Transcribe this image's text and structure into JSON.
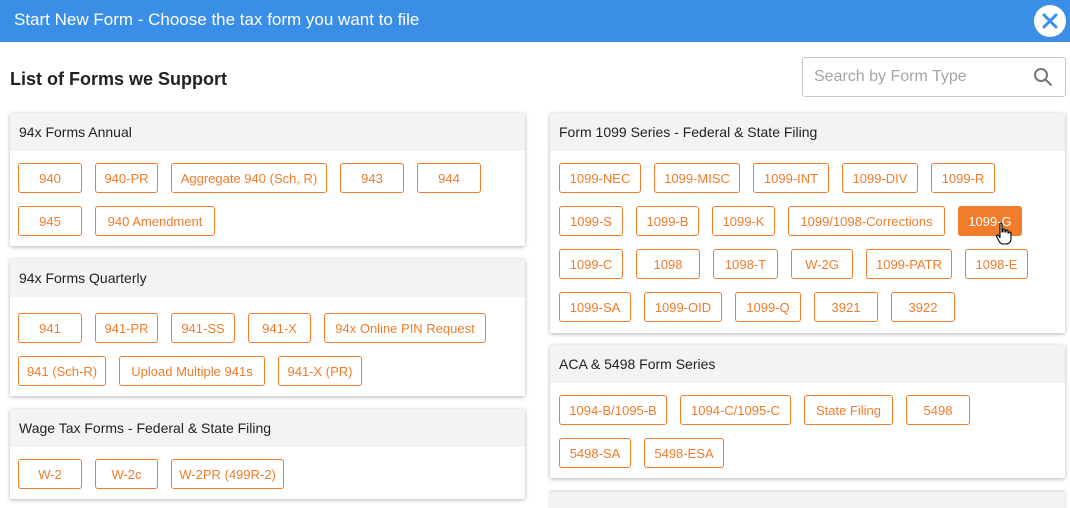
{
  "header": {
    "title": "Start New Form - Choose the tax form you want to file",
    "close_icon": "close-icon",
    "colors": {
      "bar": "#3b8ee6",
      "accent": "#f07c2c"
    }
  },
  "list_title": "List of Forms we Support",
  "search": {
    "placeholder": "Search by Form Type",
    "value": "",
    "icon": "search-icon"
  },
  "cards": {
    "annual": {
      "title": "94x Forms Annual",
      "rows": [
        [
          "940",
          "940-PR",
          "Aggregate 940 (Sch, R)",
          "943",
          "944"
        ],
        [
          "945",
          "940 Amendment"
        ]
      ]
    },
    "quarterly": {
      "title": "94x Forms Quarterly",
      "rows": [
        [
          "941",
          "941-PR",
          "941-SS",
          "941-X",
          "94x Online PIN Request"
        ],
        [
          "941 (Sch-R)",
          "Upload Multiple 941s",
          "941-X (PR)"
        ]
      ]
    },
    "wage": {
      "title": "Wage Tax Forms - Federal & State Filing",
      "rows": [
        [
          "W-2",
          "W-2c",
          "W-2PR (499R-2)"
        ]
      ]
    },
    "series_1099": {
      "title": "Form 1099 Series - Federal & State Filing",
      "rows": [
        [
          "1099-NEC",
          "1099-MISC",
          "1099-INT",
          "1099-DIV",
          "1099-R"
        ],
        [
          "1099-S",
          "1099-B",
          "1099-K",
          "1099/1098-Corrections",
          "1099-G"
        ],
        [
          "1099-C",
          "1098",
          "1098-T",
          "W-2G",
          "1099-PATR",
          "1098-E"
        ],
        [
          "1099-SA",
          "1099-OID",
          "1099-Q",
          "3921",
          "3922"
        ]
      ],
      "selected": "1099-G"
    },
    "aca": {
      "title": "ACA & 5498 Form Series",
      "rows": [
        [
          "1094-B/1095-B",
          "1094-C/1095-C",
          "State Filing",
          "5498"
        ],
        [
          "5498-SA",
          "5498-ESA"
        ]
      ]
    }
  }
}
